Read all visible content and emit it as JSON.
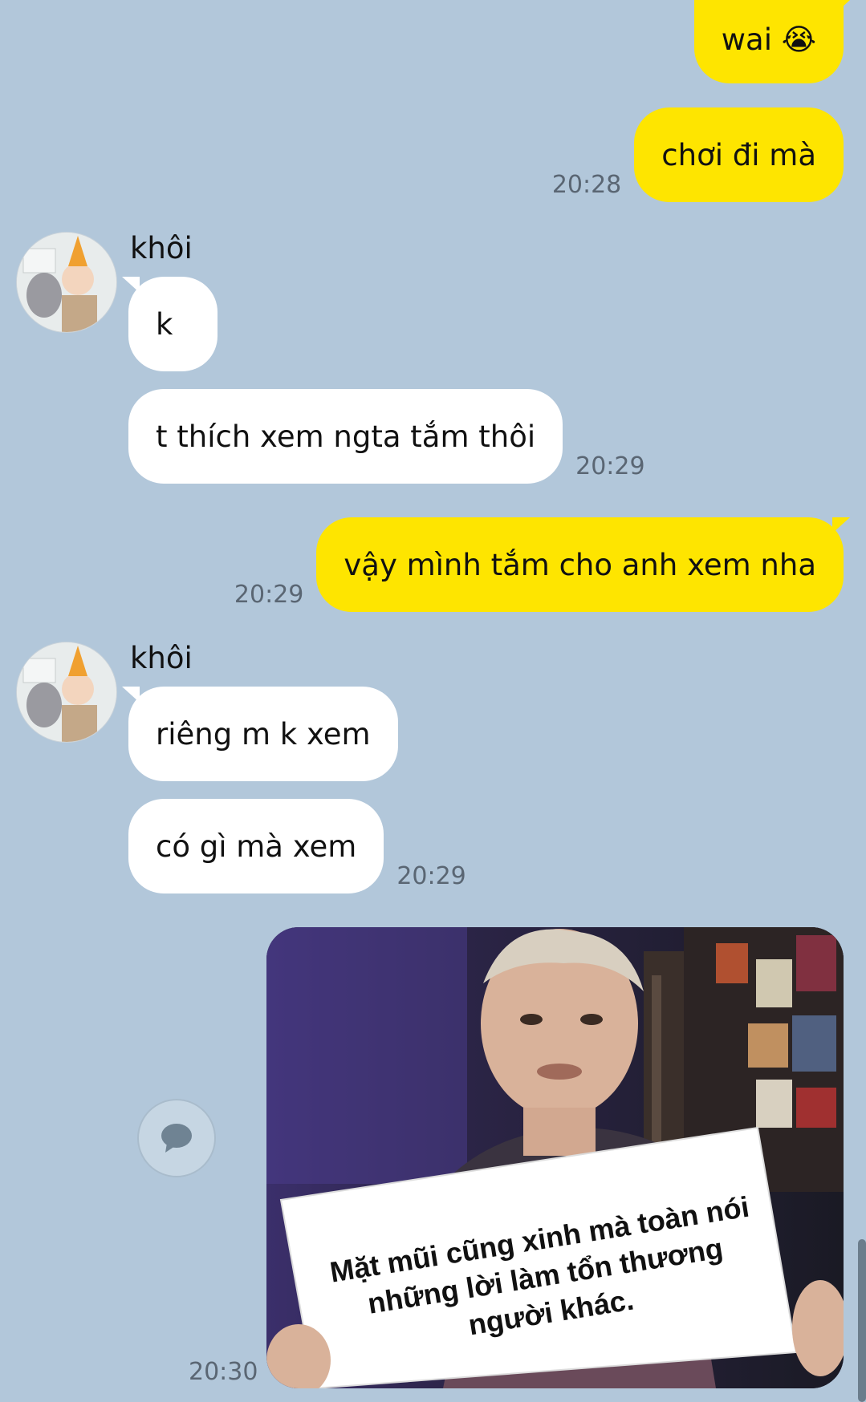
{
  "chat": {
    "messages": [
      {
        "dir": "out",
        "text": "wai 😭",
        "time": ""
      },
      {
        "dir": "out",
        "text": "chơi đi mà",
        "time": "20:28"
      },
      {
        "dir": "in",
        "sender": "khôi",
        "text": "k",
        "time": ""
      },
      {
        "dir": "in",
        "text": "t thích xem ngta tắm thôi",
        "time": "20:29"
      },
      {
        "dir": "out",
        "text": "vậy mình tắm cho anh xem nha",
        "time": "20:29"
      },
      {
        "dir": "in",
        "sender": "khôi",
        "text": "riêng m k xem",
        "time": ""
      },
      {
        "dir": "in",
        "text": "có gì mà xem",
        "time": "20:29"
      }
    ],
    "image_message": {
      "sign_text": "Mặt mũi cũng xinh mà toàn nói những lời làm tổn thương người khác.",
      "time": "20:30"
    },
    "icons": {
      "share": "speech-bubble-icon",
      "avatar": "contact-avatar"
    },
    "colors": {
      "background": "#b2c7da",
      "outgoing": "#fee500",
      "incoming": "#ffffff"
    }
  }
}
